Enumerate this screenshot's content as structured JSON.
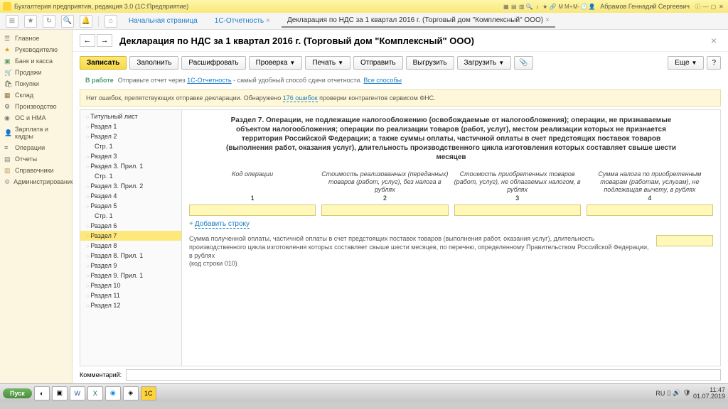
{
  "window": {
    "title": "Бухгалтерия предприятия, редакция 3.0  (1С:Предприятие)",
    "user": "Абрамов Геннадий Сергеевич"
  },
  "topnav": {
    "home": "Начальная страница",
    "tab1": "1С-Отчетность",
    "tab2": "Декларация по НДС за 1 квартал 2016 г. (Торговый дом \"Комплексный\" ООО)"
  },
  "sidebar": [
    "Главное",
    "Руководителю",
    "Банк и касса",
    "Продажи",
    "Покупки",
    "Склад",
    "Производство",
    "ОС и НМА",
    "Зарплата и кадры",
    "Операции",
    "Отчеты",
    "Справочники",
    "Администрирование"
  ],
  "header": {
    "title": "Декларация по НДС за 1 квартал 2016 г. (Торговый дом \"Комплексный\" ООО)"
  },
  "toolbar": {
    "save": "Записать",
    "fill": "Заполнить",
    "decrypt": "Расшифровать",
    "check": "Проверка",
    "print": "Печать",
    "send": "Отправить",
    "upload": "Выгрузить",
    "download": "Загрузить",
    "more": "Еще"
  },
  "status": {
    "tag": "В работе",
    "text1": "Отправьте отчет через ",
    "link1": "1С-Отчетность",
    "text2": " - самый удобный способ сдачи отчетности. ",
    "link2": "Все способы"
  },
  "yellow": {
    "text1": "Нет ошибок, препятствующих отправке декларации. Обнаружено ",
    "link": "176 ошибок",
    "text2": " проверки контрагентов сервисом ФНС."
  },
  "nav2": [
    {
      "t": "Титульный лист",
      "i": 0
    },
    {
      "t": "Раздел 1",
      "i": 0
    },
    {
      "t": "Раздел 2",
      "i": 0
    },
    {
      "t": "Стр. 1",
      "i": 1
    },
    {
      "t": "Раздел 3",
      "i": 0
    },
    {
      "t": "Раздел 3. Прил. 1",
      "i": 0
    },
    {
      "t": "Стр. 1",
      "i": 1
    },
    {
      "t": "Раздел 3. Прил. 2",
      "i": 0
    },
    {
      "t": "Раздел 4",
      "i": 0
    },
    {
      "t": "Раздел 5",
      "i": 0
    },
    {
      "t": "Стр. 1",
      "i": 1
    },
    {
      "t": "Раздел 6",
      "i": 0
    },
    {
      "t": "Раздел 7",
      "i": 0,
      "a": 1
    },
    {
      "t": "Раздел 8",
      "i": 0
    },
    {
      "t": "Раздел 8. Прил. 1",
      "i": 0
    },
    {
      "t": "Раздел 9",
      "i": 0
    },
    {
      "t": "Раздел 9. Прил. 1",
      "i": 0
    },
    {
      "t": "Раздел 10",
      "i": 0
    },
    {
      "t": "Раздел 11",
      "i": 0
    },
    {
      "t": "Раздел 12",
      "i": 0
    }
  ],
  "form": {
    "title": "Раздел 7. Операции, не подлежащие налогообложению (освобождаемые от налогообложения); операции, не признаваемые объектом налогообложения; операции по реализации товаров (работ, услуг), местом реализации которых не признается территория Российской Федерации; а также суммы оплаты, частичной оплаты в счет предстоящих поставок товаров (выполнения работ, оказания услуг), длительность производственного цикла изготовления которых составляет свыше шести месяцев",
    "cols": [
      "Код операции",
      "Стоимость реализованных (переданных) товаров (работ, услуг), без налога в рублях",
      "Стоимость приобретенных товаров (работ, услуг), не облагаемых налогом, в рублях",
      "Сумма налога по приобретенным товарам (работам, услугам), не подлежащая вычету, в рублях"
    ],
    "nums": [
      "1",
      "2",
      "3",
      "4"
    ],
    "addrow": "Добавить строку",
    "desc": "Сумма полученной оплаты, частичной оплаты в счет предстоящих поставок товаров (выполнения работ, оказания услуг), длительность производственного цикла изготовления которых составляет свыше шести месяцев, по перечню, определенному Правительством Российской Федерации, в рублях",
    "desc2": "(код строки 010)"
  },
  "comment_label": "Комментарий:",
  "taskbar": {
    "start": "Пуск",
    "lang": "RU",
    "time": "11:47",
    "date": "01.07.2019"
  }
}
